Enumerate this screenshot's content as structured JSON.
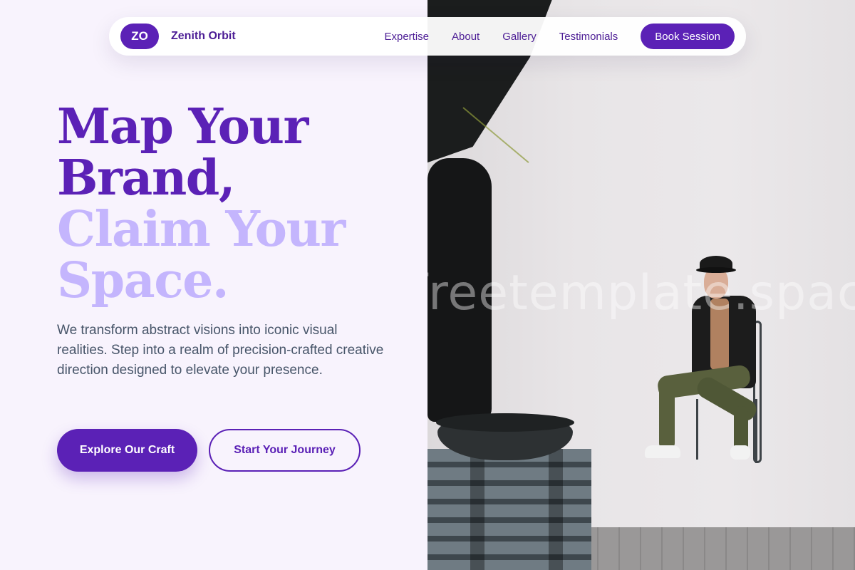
{
  "nav": {
    "logo_initials": "ZO",
    "brand_name": "Zenith Orbit",
    "links": [
      "Expertise",
      "About",
      "Gallery",
      "Testimonials"
    ],
    "cta_label": "Book Session"
  },
  "hero": {
    "headline_dark": [
      "Map Your",
      "Brand,"
    ],
    "headline_light": [
      "Claim Your",
      "Space."
    ],
    "lead": "We transform abstract visions into iconic visual realities. Step into a realm of precision-crafted creative direction designed to elevate your presence.",
    "primary_button": "Explore Our Craft",
    "secondary_button": "Start Your Journey"
  },
  "photo": {
    "watermark": "freetemplate.space"
  },
  "colors": {
    "accent": "#5b21b6",
    "accent_light": "#c4b5fd",
    "background": "#f8f3fd",
    "body_text": "#475569"
  }
}
